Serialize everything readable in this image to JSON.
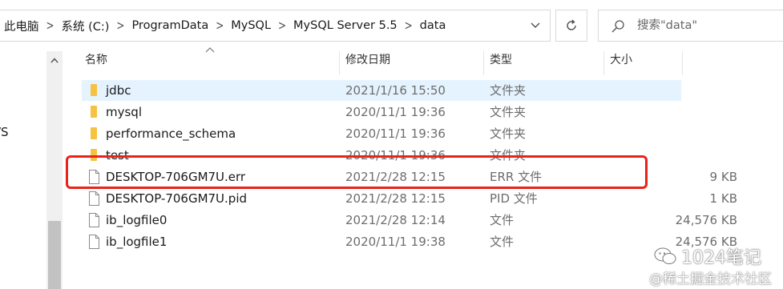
{
  "breadcrumb": [
    "此电脑",
    "系统 (C:)",
    "ProgramData",
    "MySQL",
    "MySQL Server 5.5",
    "data"
  ],
  "search": {
    "placeholder": "搜索\"data\""
  },
  "nav": {
    "partial_text": "/S"
  },
  "columns": {
    "name": "名称",
    "date": "修改日期",
    "type": "类型",
    "size": "大小"
  },
  "files": [
    {
      "name": "jdbc",
      "date": "2021/1/16 15:50",
      "type": "文件夹",
      "size": "",
      "icon": "folder-icon",
      "selected": true
    },
    {
      "name": "mysql",
      "date": "2020/11/1 19:36",
      "type": "文件夹",
      "size": "",
      "icon": "folder-icon"
    },
    {
      "name": "performance_schema",
      "date": "2020/11/1 19:36",
      "type": "文件夹",
      "size": "",
      "icon": "folder-icon"
    },
    {
      "name": "test",
      "date": "2020/11/1 19:36",
      "type": "文件夹",
      "size": "",
      "icon": "folder-icon"
    },
    {
      "name": "DESKTOP-706GM7U.err",
      "date": "2021/2/28 12:15",
      "type": "ERR 文件",
      "size": "9 KB",
      "icon": "file-icon",
      "highlighted": true
    },
    {
      "name": "DESKTOP-706GM7U.pid",
      "date": "2021/2/28 12:15",
      "type": "PID 文件",
      "size": "1 KB",
      "icon": "file-icon"
    },
    {
      "name": "ib_logfile0",
      "date": "2021/2/28 12:14",
      "type": "文件",
      "size": "24,576 KB",
      "icon": "file-icon"
    },
    {
      "name": "ib_logfile1",
      "date": "2020/11/1 19:38",
      "type": "文件",
      "size": "24,576 KB",
      "icon": "file-icon"
    }
  ],
  "watermark": {
    "line1": "1024笔记",
    "line2": "@稀土掘金技术社区"
  },
  "colors": {
    "selection": "#e5f3ff",
    "highlight_box": "#e8231a",
    "folder": "#f5c242",
    "text_muted": "#6d6d6d"
  }
}
